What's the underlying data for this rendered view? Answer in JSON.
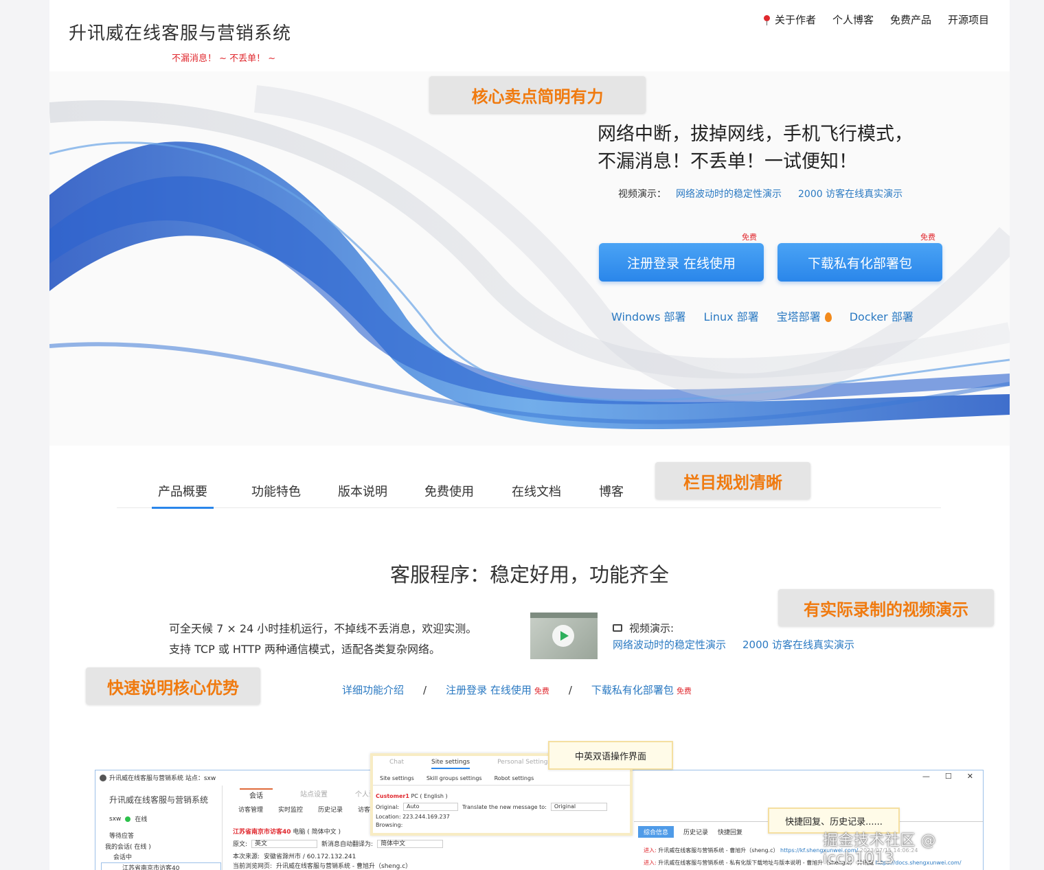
{
  "header": {
    "title": "升讯威在线客服与营销系统",
    "slogan": "不漏消息！ ~ 不丢单！ ~",
    "nav": [
      "关于作者",
      "个人博客",
      "免费产品",
      "开源项目"
    ]
  },
  "hero": {
    "line1": "网络中断，拔掉网线，手机飞行模式，",
    "line2": "不漏消息！不丢单！一试便知！",
    "video_label": "视频演示：",
    "video_links": [
      "网络波动时的稳定性演示",
      "2000 访客在线真实演示"
    ],
    "cta_register": "注册登录 在线使用",
    "cta_download": "下载私有化部署包",
    "free_tag": "免费",
    "deploy_links": [
      "Windows 部署",
      "Linux 部署",
      "宝塔部署",
      "Docker 部署"
    ]
  },
  "callouts": {
    "core": "核心卖点简明有力",
    "columns": "栏目规划清晰",
    "video": "有实际录制的视频演示",
    "quick": "快速说明核心优势"
  },
  "tabs": [
    "产品概要",
    "功能特色",
    "版本说明",
    "免费使用",
    "在线文档",
    "博客"
  ],
  "section": {
    "title": "客服程序：稳定好用，功能齐全",
    "p1": "可全天候 7 × 24 小时挂机运行，不掉线不丢消息，欢迎实测。",
    "p2": "支持 TCP 或 HTTP 两种通信模式，适配各类复杂网络。",
    "video_label": "视频演示:",
    "video_links": [
      "网络波动时的稳定性演示",
      "2000 访客在线真实演示"
    ],
    "quick_links": [
      "详细功能介绍",
      "注册登录 在线使用",
      "下载私有化部署包"
    ],
    "sep": "/",
    "free": "免费"
  },
  "app": {
    "window_title": "升讯威在线客服与营销系统  站点：sxw",
    "controls": [
      "—",
      "☐",
      "✕"
    ],
    "brand": "升讯威在线客服与营销系统",
    "user": "sxw",
    "status": "在线",
    "side_items": [
      "等待应答",
      "我的会话( 在线 )",
      "会话中",
      "江苏省南京市访客40"
    ],
    "main_tabs": [
      "会话",
      "站点设置",
      "个人设置"
    ],
    "sub_tabs": [
      "访客管理",
      "实时监控",
      "历史记录",
      "访客"
    ],
    "visitor": "江苏省南京市访客40",
    "visitor_meta": "电脑 ( 简体中文 )",
    "lang_label": "原文:",
    "lang_value": "英文",
    "auto_trans_label": "新消息自动翻译为:",
    "auto_trans_value": "简体中文",
    "source_label": "本次来源:",
    "source_value": "安徽省滁州市 / 60.172.132.241",
    "current_label": "当前浏览网页:",
    "current_value": "升讯威在线客服与营销系统 - 曹旭升（sheng.c）",
    "right_tabs": [
      "综合信息",
      "历史记录",
      "快捷回复"
    ],
    "right_line1_label": "进入:",
    "right_line1_text": "升讯威在线客服与营销系统 - 曹旭升（sheng.c）",
    "right_line1_link": "https://kf.shengxunwei.com/",
    "right_line1_time": "2023/07/15 14:06:24",
    "right_line2_label": "进入:",
    "right_line2_text": "升讯威在线客服与营销系统 - 私有化版下载地址与版本说明",
    "right_line2_text2": "- 曹旭升（sheng.c） 升讯威",
    "right_line2_link": "https://docs.shengxunwei.com/"
  },
  "popup": {
    "tabs": [
      "Chat",
      "Site settings",
      "Personal Settings"
    ],
    "sub": [
      "Site settings",
      "Skill groups settings",
      "Robot settings"
    ],
    "customer": "Customer1",
    "customer_meta": "PC ( English )",
    "original_label": "Original:",
    "original_value": "Auto",
    "translate_label": "Translate the new message to:",
    "translate_value": "Original",
    "location": "Location:    223.244.169.237",
    "browsing": "Browsing:"
  },
  "notes": {
    "bilingual": "中英双语操作界面",
    "quick_reply": "快捷回复、历史记录......"
  },
  "watermark": "掘金技术社区 @ iccb1013"
}
